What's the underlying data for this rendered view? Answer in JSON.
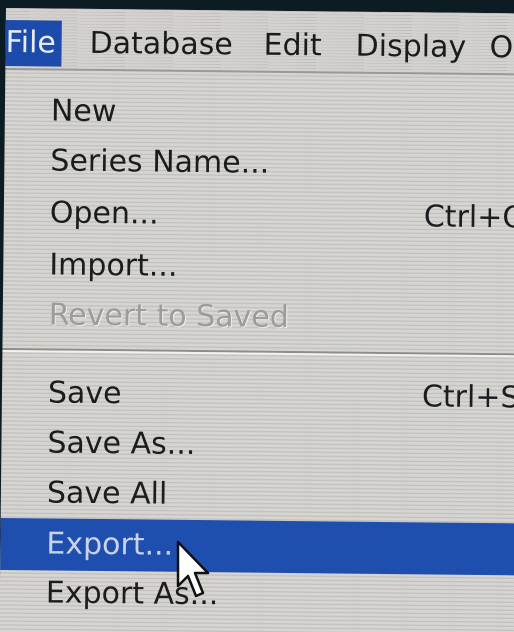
{
  "menubar": {
    "items": [
      {
        "label": "File",
        "active": true
      },
      {
        "label": "Database"
      },
      {
        "label": "Edit"
      },
      {
        "label": "Display"
      },
      {
        "label": "O"
      }
    ]
  },
  "file_menu": {
    "items": [
      {
        "label": "New",
        "shortcut": ""
      },
      {
        "label": "Series Name...",
        "shortcut": ""
      },
      {
        "label": "Open...",
        "shortcut": "Ctrl+O"
      },
      {
        "label": "Import...",
        "shortcut": ""
      },
      {
        "label": "Revert to Saved",
        "shortcut": "",
        "disabled": true
      },
      {
        "label": "Save",
        "shortcut": "Ctrl+S"
      },
      {
        "label": "Save As...",
        "shortcut": ""
      },
      {
        "label": "Save All",
        "shortcut": ""
      },
      {
        "label": "Export...",
        "shortcut": "",
        "highlighted": true
      },
      {
        "label": "Export As...",
        "shortcut": ""
      }
    ]
  },
  "cursor": {
    "icon": "arrow-pointer-icon"
  }
}
